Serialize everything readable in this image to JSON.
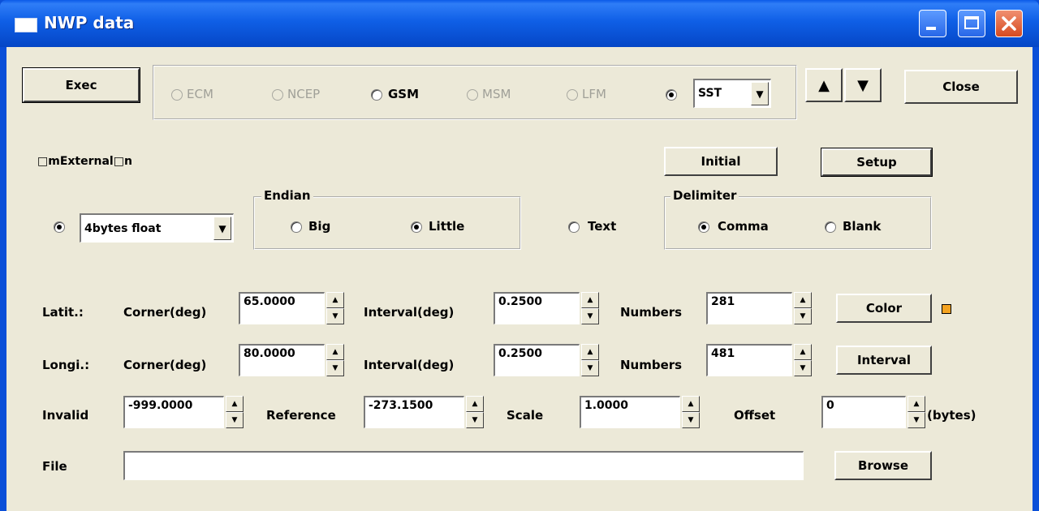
{
  "window": {
    "title": "NWP data"
  },
  "toolbar": {
    "exec_label": "Exec",
    "close_label": "Close"
  },
  "models": [
    {
      "label": "ECM",
      "enabled": false,
      "selected": false
    },
    {
      "label": "NCEP",
      "enabled": false,
      "selected": false
    },
    {
      "label": "GSM",
      "enabled": true,
      "selected": false
    },
    {
      "label": "MSM",
      "enabled": false,
      "selected": false
    },
    {
      "label": "LFM",
      "enabled": false,
      "selected": false
    },
    {
      "label": "",
      "enabled": true,
      "selected": true
    }
  ],
  "sst_select": {
    "value": "SST"
  },
  "nav": {
    "up": "▲",
    "down": "▼"
  },
  "external_label": "□mExternal□n",
  "buttons": {
    "initial": "Initial",
    "setup": "Setup",
    "color": "Color",
    "interval": "Interval",
    "browse": "Browse"
  },
  "format": {
    "binary_selected": true,
    "type_value": "4bytes float"
  },
  "endian": {
    "legend": "Endian",
    "big": "Big",
    "little": "Little",
    "selected": "Little"
  },
  "text_option": {
    "label": "Text",
    "selected": false
  },
  "delimiter": {
    "legend": "Delimiter",
    "comma": "Comma",
    "blank": "Blank",
    "selected": "Comma"
  },
  "latitude": {
    "label": "Latit.:",
    "corner_label": "Corner(deg)",
    "corner": "65.0000",
    "interval_label": "Interval(deg)",
    "interval": "0.2500",
    "numbers_label": "Numbers",
    "numbers": "281"
  },
  "longitude": {
    "label": "Longi.:",
    "corner_label": "Corner(deg)",
    "corner": "80.0000",
    "interval_label": "Interval(deg)",
    "interval": "0.2500",
    "numbers_label": "Numbers",
    "numbers": "481"
  },
  "params": {
    "invalid_label": "Invalid",
    "invalid": "-999.0000",
    "reference_label": "Reference",
    "reference": "-273.1500",
    "scale_label": "Scale",
    "scale": "1.0000",
    "offset_label": "Offset",
    "offset": "0",
    "offset_unit": "(bytes)"
  },
  "file": {
    "label": "File",
    "value": ""
  },
  "colors": {
    "title_bar": "#0a4fd8",
    "dialog_bg": "#ece9d8",
    "color_swatch": "#f4a320"
  }
}
